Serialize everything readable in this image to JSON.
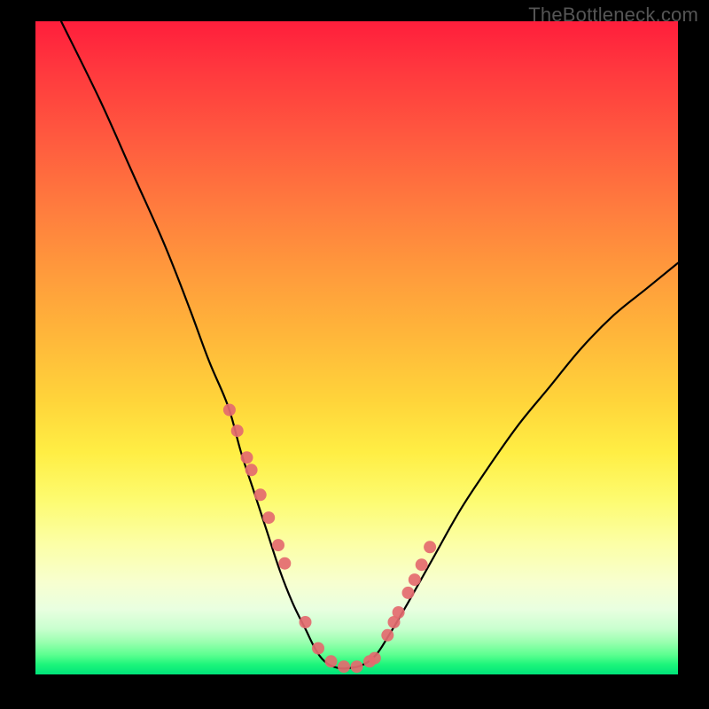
{
  "watermark": "TheBottleneck.com",
  "colors": {
    "frame_bg": "#000000",
    "curve": "#000000",
    "dot": "#e46a6f"
  },
  "chart_data": {
    "type": "line",
    "title": "",
    "xlabel": "",
    "ylabel": "",
    "xlim": [
      0,
      100
    ],
    "ylim": [
      0,
      100
    ],
    "series": [
      {
        "name": "bottleneck-curve",
        "x": [
          4,
          10,
          15,
          20,
          24,
          27,
          30,
          32,
          34,
          36,
          38,
          40,
          42,
          43.5,
          45,
          47,
          49,
          51,
          53,
          55,
          58,
          62,
          66,
          70,
          75,
          80,
          85,
          90,
          95,
          100
        ],
        "y": [
          100,
          88,
          77,
          66,
          56,
          48,
          41,
          34,
          28,
          22,
          16,
          11,
          7,
          4,
          2,
          1,
          1,
          1.5,
          3,
          6,
          11,
          18,
          25,
          31,
          38,
          44,
          50,
          55,
          59,
          63
        ]
      }
    ],
    "markers": {
      "name": "highlight-dots",
      "x": [
        30.2,
        31.4,
        32.9,
        33.6,
        35.0,
        36.3,
        37.8,
        38.8,
        42.0,
        44.0,
        46.0,
        48.0,
        50.0,
        52.0,
        52.8,
        54.8,
        55.8,
        56.5,
        58.0,
        59.0,
        60.1,
        61.4
      ],
      "y": [
        40.5,
        37.3,
        33.2,
        31.3,
        27.5,
        24.0,
        19.8,
        17.0,
        8.0,
        4.0,
        2.0,
        1.2,
        1.2,
        2.0,
        2.5,
        6.0,
        8.0,
        9.5,
        12.5,
        14.5,
        16.8,
        19.5
      ],
      "r": 7
    }
  }
}
